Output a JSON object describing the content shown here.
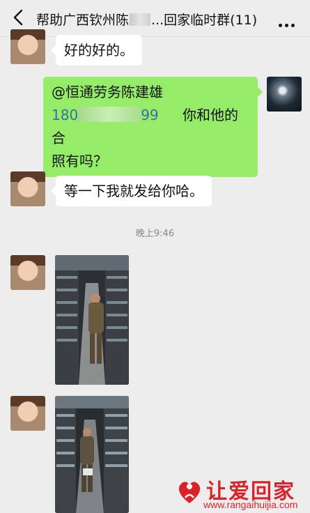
{
  "header": {
    "title_prefix": "帮助广西钦州陈",
    "title_suffix": "...回家临时群(11)",
    "back_icon": "chevron-left-icon",
    "more_icon": "more-dots-icon"
  },
  "messages": [
    {
      "side": "left",
      "text": "好的好的。"
    },
    {
      "side": "right",
      "mention": "@恒通劳务陈建雄",
      "phone_start": "180",
      "phone_end": "99",
      "text_tail": "你和他的合",
      "text_line3": "照有吗？"
    },
    {
      "side": "left",
      "text": "等一下我就发给你哈。"
    }
  ],
  "timestamp": "晚上9:46",
  "watermark": {
    "brand": "让爱回家",
    "url": "www.rangaihuijia.com"
  },
  "colors": {
    "background": "#ededed",
    "my_bubble": "#95ec69",
    "their_bubble": "#ffffff",
    "watermark_red": "#d8232a"
  }
}
